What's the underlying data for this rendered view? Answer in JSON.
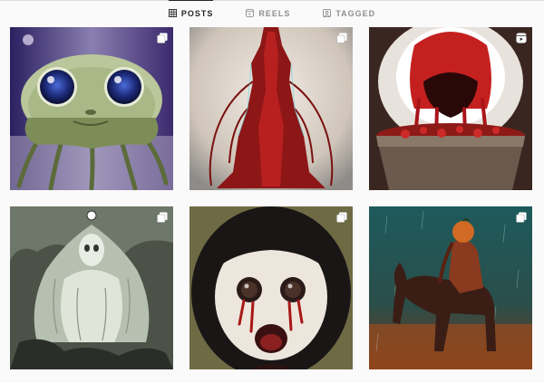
{
  "tabs": [
    {
      "label": "POSTS",
      "icon": "grid-icon",
      "active": true
    },
    {
      "label": "REELS",
      "icon": "reels-icon",
      "active": false
    },
    {
      "label": "TAGGED",
      "icon": "tagged-icon",
      "active": false
    }
  ],
  "posts": [
    {
      "subject": "green creature with big blue eyes",
      "badge": "multiple-posts-icon"
    },
    {
      "subject": "red dripping figure",
      "badge": "multiple-posts-icon"
    },
    {
      "subject": "bleeding mouth in bucket",
      "badge": "reel-icon"
    },
    {
      "subject": "pale ghostly figure",
      "badge": "multiple-posts-icon"
    },
    {
      "subject": "pale doll face with bleeding eyes",
      "badge": "multiple-posts-icon"
    },
    {
      "subject": "headless horseman in rain",
      "badge": "multiple-posts-icon"
    }
  ],
  "colors": {
    "active_tab": "#262626",
    "inactive_tab": "#8e8e8e",
    "divider": "#dbdbdb",
    "background": "#fafafa"
  }
}
